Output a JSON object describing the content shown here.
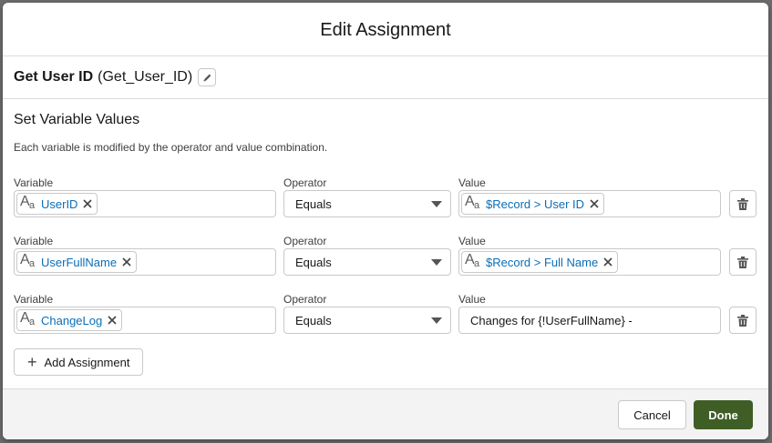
{
  "modal": {
    "title": "Edit Assignment"
  },
  "element": {
    "label": "Get User ID",
    "api_name": "(Get_User_ID)",
    "edit_icon": "pencil-icon"
  },
  "section": {
    "title": "Set Variable Values",
    "description": "Each variable is modified by the operator and value combination."
  },
  "column_labels": {
    "variable": "Variable",
    "operator": "Operator",
    "value": "Value"
  },
  "assignments": [
    {
      "variable": "UserID",
      "operator": "Equals",
      "value_type": "pill",
      "value": "$Record > User ID"
    },
    {
      "variable": "UserFullName",
      "operator": "Equals",
      "value_type": "pill",
      "value": "$Record > Full Name"
    },
    {
      "variable": "ChangeLog",
      "operator": "Equals",
      "value_type": "text",
      "value": "Changes for {!UserFullName} -"
    }
  ],
  "add_button": {
    "label": "Add Assignment"
  },
  "footer": {
    "cancel_label": "Cancel",
    "done_label": "Done"
  },
  "colors": {
    "pill_text": "#0b6eb7",
    "done_button": "#3e5e26"
  }
}
